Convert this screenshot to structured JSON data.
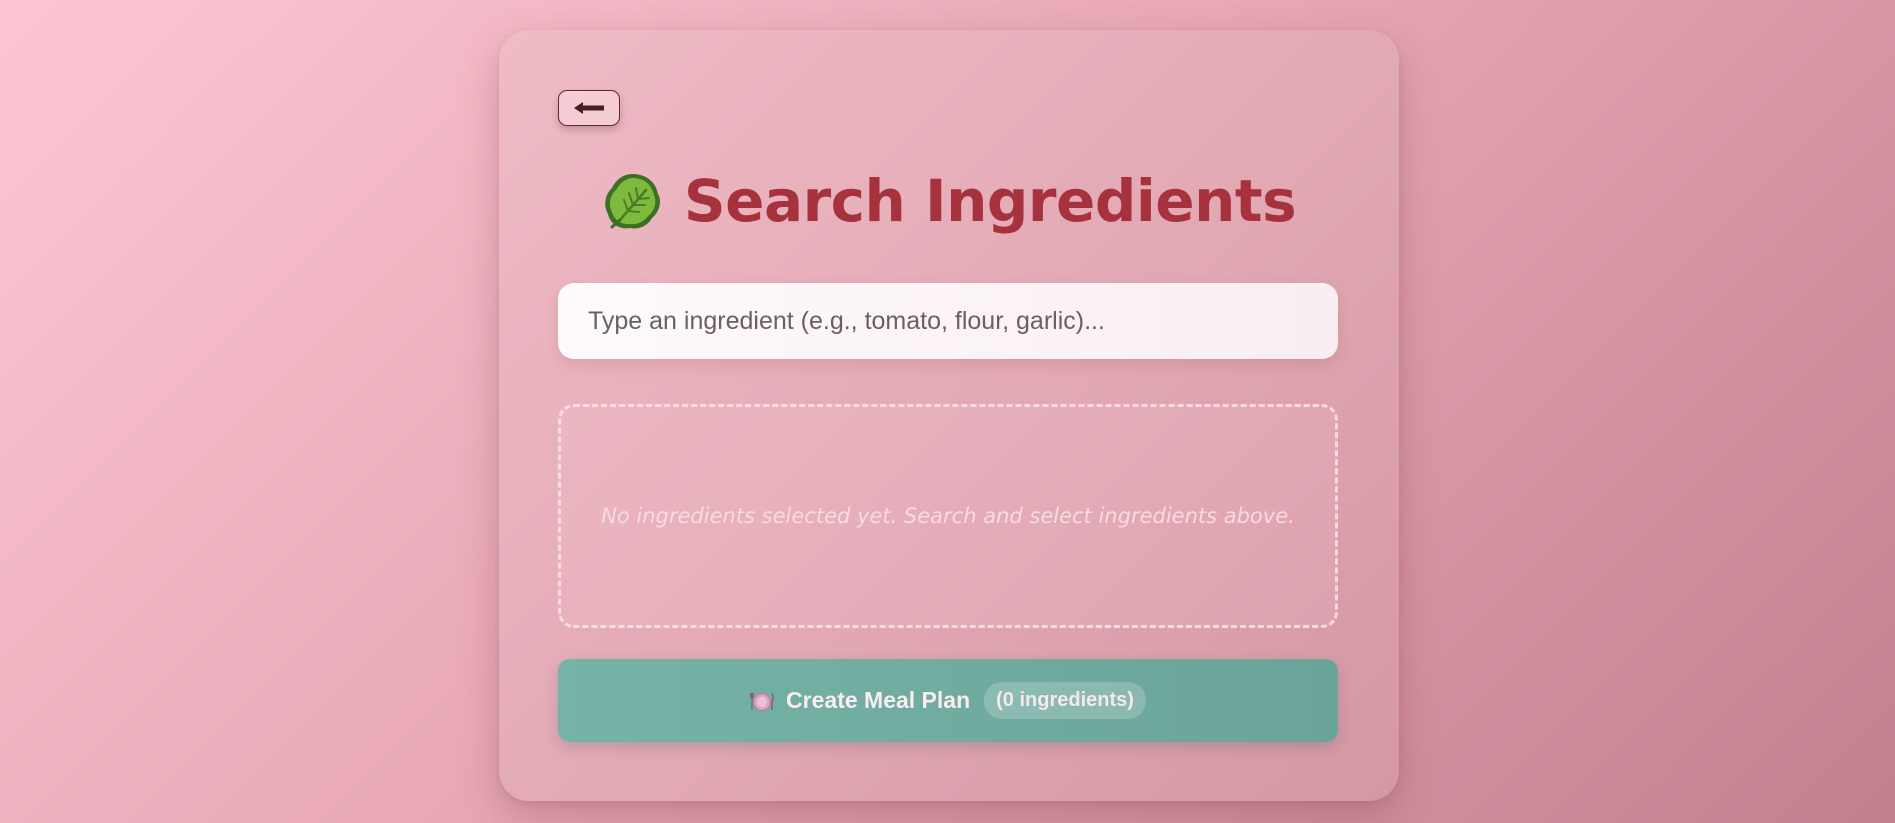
{
  "page": {
    "background_colors": [
      "#fdc6d3",
      "#c2808f"
    ],
    "title": "Search Ingredients",
    "title_icon": "leafy-green-icon",
    "title_color": "#a6323d"
  },
  "back_button": {
    "icon": "arrow-left-icon"
  },
  "search": {
    "placeholder": "Type an ingredient (e.g., tomato, flour, garlic)...",
    "value": ""
  },
  "selected_ingredients": {
    "items": [],
    "empty_message": "No ingredients selected yet. Search and select ingredients above."
  },
  "create_button": {
    "icon": "plate-icon",
    "label": "Create Meal Plan",
    "count_label": "(0 ingredients)",
    "color": "#75b3a6"
  }
}
